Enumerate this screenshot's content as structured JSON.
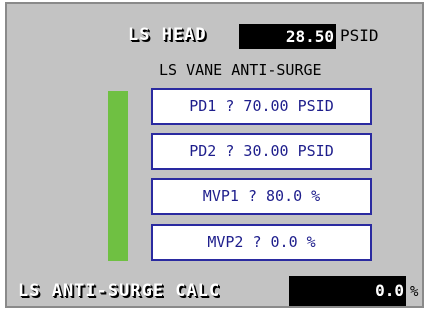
{
  "ls_head": {
    "label": "LS HEAD",
    "value": "28.50",
    "unit": "PSID"
  },
  "section_title": "LS VANE ANTI-SURGE",
  "surge_indicator": {
    "color": "#6fc042"
  },
  "setpoints": [
    {
      "text": "PD1  ? 70.00 PSID"
    },
    {
      "text": "PD2  ? 30.00 PSID"
    },
    {
      "text": "MVP1  ? 80.0 %"
    },
    {
      "text": "MVP2  ? 0.0 %"
    }
  ],
  "anti_surge_calc": {
    "label": "LS ANTI-SURGE CALC",
    "value": "0.0",
    "unit": "%"
  },
  "colors": {
    "panel": "#c3c3c3",
    "setpoint_border": "#2a2aa0",
    "setpoint_text": "#1e1e8c"
  }
}
